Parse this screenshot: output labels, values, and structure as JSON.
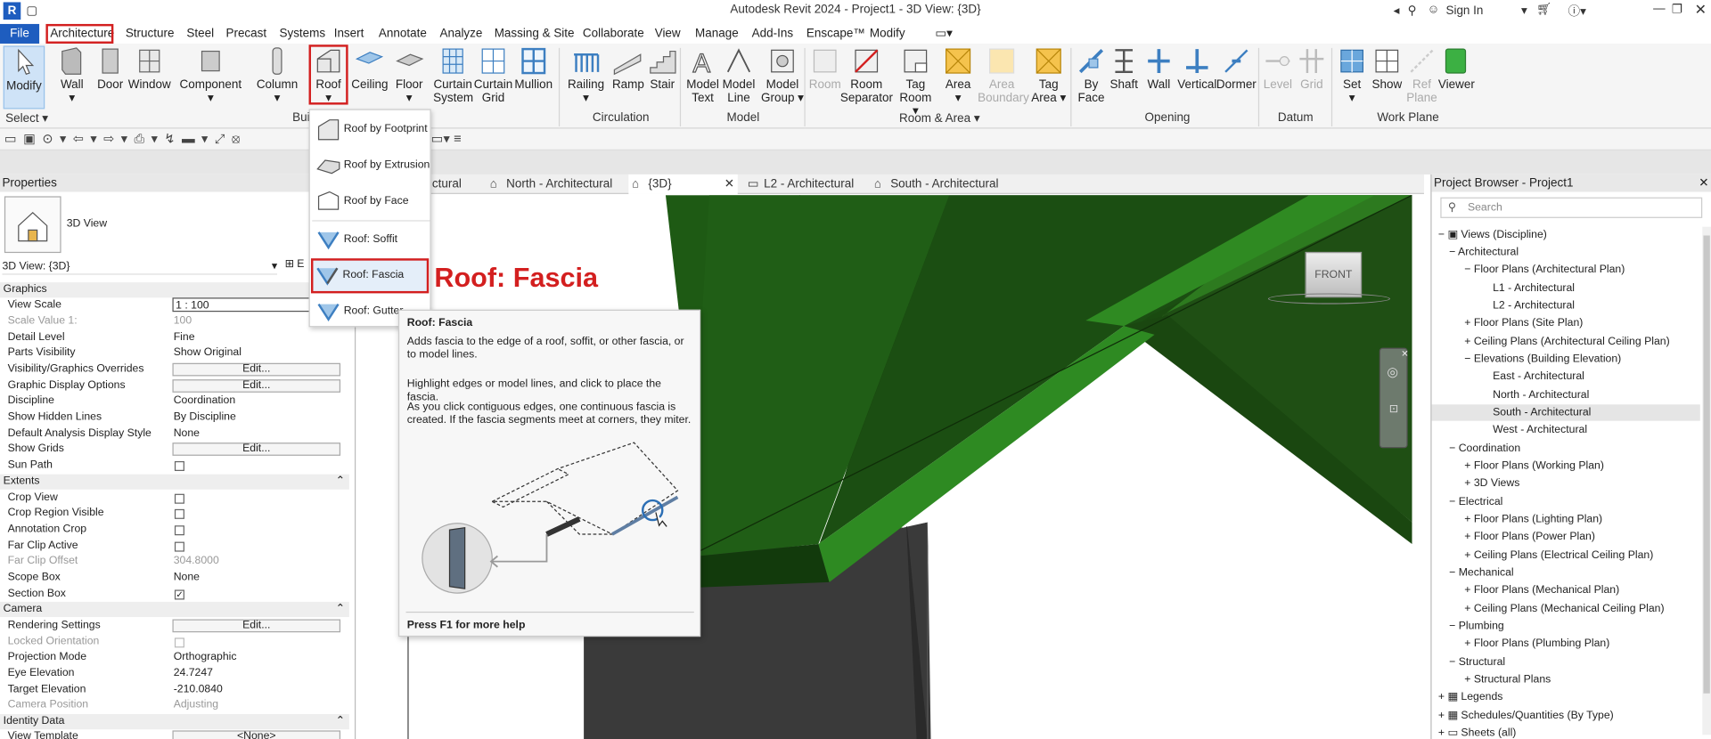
{
  "window": {
    "title": "Autodesk Revit 2024 - Project1 - 3D View: {3D}",
    "sign_in": "Sign In",
    "logo": "R"
  },
  "menu": [
    "File",
    "Architecture",
    "Structure",
    "Steel",
    "Precast",
    "Systems",
    "Insert",
    "Annotate",
    "Analyze",
    "Massing & Site",
    "Collaborate",
    "View",
    "Manage",
    "Add-Ins",
    "Enscape™",
    "Modify"
  ],
  "ribbon": {
    "buttons": [
      "Modify",
      "Wall",
      "Door",
      "Window",
      "Component",
      "Column",
      "Roof",
      "Ceiling",
      "Floor",
      "Curtain System",
      "Curtain Grid",
      "Mullion",
      "Railing",
      "Ramp",
      "Stair",
      "Model Text",
      "Model Line",
      "Model Group",
      "Room",
      "Room Separator",
      "Tag Room",
      "Area",
      "Area Boundary",
      "Tag Area",
      "By Face",
      "Shaft",
      "Wall",
      "Vertical",
      "Dormer",
      "Level",
      "Grid",
      "Set",
      "Show",
      "Ref Plane",
      "Viewer"
    ],
    "panels": [
      "Select",
      "Bui",
      "Circulation",
      "Model",
      "Room & Area",
      "Opening",
      "Datum",
      "Work Plane"
    ]
  },
  "roof_menu": [
    "Roof by Footprint",
    "Roof by Extrusion",
    "Roof by Face",
    "Roof: Soffit",
    "Roof: Fascia",
    "Roof: Gutter"
  ],
  "callout": "Roof: Fascia",
  "tooltip": {
    "title": "Roof: Fascia",
    "p1": "Adds fascia to the edge of a roof, soffit, or other fascia, or to model lines.",
    "p2": "Highlight edges or model lines, and click to place the fascia.",
    "p3": "As you click contiguous edges, one continuous fascia is created. If the fascia segments meet at corners, they miter.",
    "help": "Press F1 for more help"
  },
  "view_tabs": [
    "ctural",
    "North - Architectural",
    "{3D}",
    "L2 - Architectural",
    "South - Architectural"
  ],
  "properties": {
    "header": "Properties",
    "type": "3D View",
    "selector": "3D View: {3D}",
    "edit_type": "E",
    "sections": {
      "graphics": "Graphics",
      "extents": "Extents",
      "camera": "Camera",
      "identity": "Identity Data"
    },
    "rows": {
      "view_scale": [
        "View Scale",
        "1 : 100"
      ],
      "scale_value": [
        "Scale Value    1:",
        "100"
      ],
      "detail_level": [
        "Detail Level",
        "Fine"
      ],
      "parts_visibility": [
        "Parts Visibility",
        "Show Original"
      ],
      "vg_overrides": [
        "Visibility/Graphics Overrides",
        "Edit..."
      ],
      "graphic_display": [
        "Graphic Display Options",
        "Edit..."
      ],
      "discipline": [
        "Discipline",
        "Coordination"
      ],
      "hidden_lines": [
        "Show Hidden Lines",
        "By Discipline"
      ],
      "analysis_display": [
        "Default Analysis Display Style",
        "None"
      ],
      "show_grids": [
        "Show Grids",
        "Edit..."
      ],
      "sun_path": [
        "Sun Path",
        ""
      ],
      "crop_view": [
        "Crop View",
        ""
      ],
      "crop_region": [
        "Crop Region Visible",
        ""
      ],
      "annotation_crop": [
        "Annotation Crop",
        ""
      ],
      "far_clip_active": [
        "Far Clip Active",
        ""
      ],
      "far_clip_offset": [
        "Far Clip Offset",
        "304.8000"
      ],
      "scope_box": [
        "Scope Box",
        "None"
      ],
      "section_box": [
        "Section Box",
        ""
      ],
      "rendering": [
        "Rendering Settings",
        "Edit..."
      ],
      "locked_orientation": [
        "Locked Orientation",
        ""
      ],
      "projection": [
        "Projection Mode",
        "Orthographic"
      ],
      "eye_elev": [
        "Eye Elevation",
        "24.7247"
      ],
      "target_elev": [
        "Target Elevation",
        "-210.0840"
      ],
      "camera_pos": [
        "Camera Position",
        "Adjusting"
      ],
      "view_template": [
        "View Template",
        "<None>"
      ]
    }
  },
  "viewcube": "FRONT",
  "browser": {
    "title": "Project Browser - Project1",
    "search": "Search",
    "tree": [
      "Views (Discipline)",
      "Architectural",
      "Floor Plans (Architectural Plan)",
      "L1 - Architectural",
      "L2 - Architectural",
      "Floor Plans (Site Plan)",
      "Ceiling Plans (Architectural Ceiling Plan)",
      "Elevations (Building Elevation)",
      "East - Architectural",
      "North - Architectural",
      "South - Architectural",
      "West - Architectural",
      "Coordination",
      "Floor Plans (Working Plan)",
      "3D Views",
      "Electrical",
      "Floor Plans (Lighting Plan)",
      "Floor Plans (Power Plan)",
      "Ceiling Plans (Electrical Ceiling Plan)",
      "Mechanical",
      "Floor Plans (Mechanical Plan)",
      "Ceiling Plans (Mechanical Ceiling Plan)",
      "Plumbing",
      "Floor Plans (Plumbing Plan)",
      "Structural",
      "Structural Plans",
      "Legends",
      "Schedules/Quantities (By Type)",
      "Sheets (all)"
    ]
  }
}
